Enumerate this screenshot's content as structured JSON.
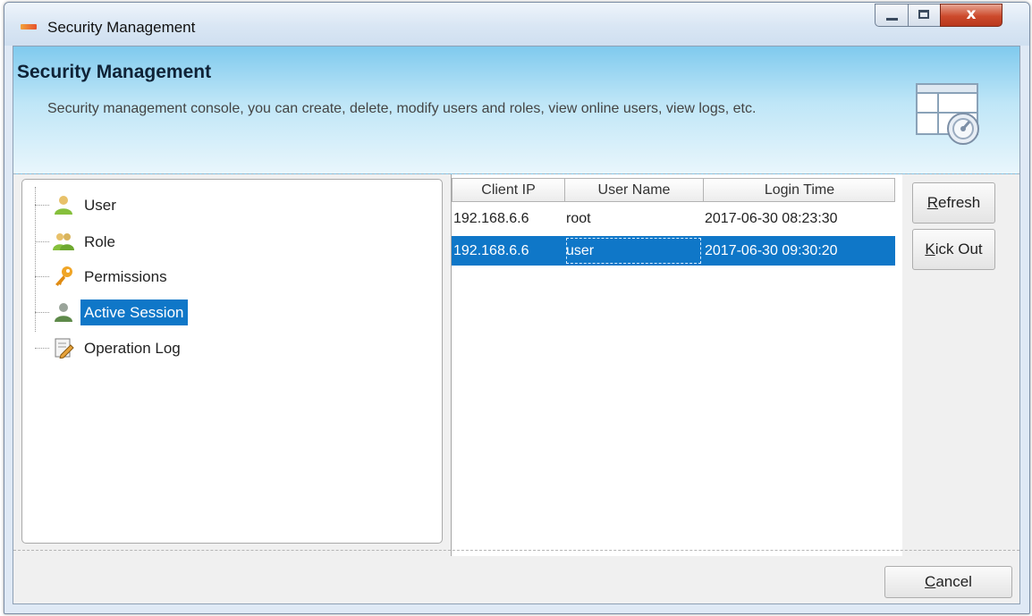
{
  "window": {
    "title": "Security Management",
    "logo_icon": "app-logo-icon",
    "controls": {
      "minimize_icon": "minimize-icon",
      "maximize_icon": "maximize-icon",
      "close_icon": "close-icon",
      "close_glyph": "x"
    }
  },
  "header": {
    "title": "Security Management",
    "description": "Security management console, you can create, delete, modify users and roles, view online users, view logs, etc.",
    "art_icon": "security-console-icon"
  },
  "tree": {
    "items": [
      {
        "label": "User",
        "icon": "user-icon",
        "selected": false
      },
      {
        "label": "Role",
        "icon": "role-icon",
        "selected": false
      },
      {
        "label": "Permissions",
        "icon": "key-icon",
        "selected": false
      },
      {
        "label": "Active Session",
        "icon": "session-user-icon",
        "selected": true
      },
      {
        "label": "Operation Log",
        "icon": "log-icon",
        "selected": false
      }
    ]
  },
  "sessions": {
    "columns": [
      "Client IP",
      "User Name",
      "Login Time"
    ],
    "rows": [
      {
        "client_ip": "192.168.6.6",
        "user_name": "root",
        "login_time": "2017-06-30 08:23:30",
        "selected": false
      },
      {
        "client_ip": "192.168.6.6",
        "user_name": "user",
        "login_time": "2017-06-30 09:30:20",
        "selected": true
      }
    ]
  },
  "actions": {
    "refresh": {
      "mnemonic": "R",
      "rest": "efresh"
    },
    "kick_out": {
      "mnemonic": "K",
      "rest": "ick Out"
    },
    "cancel": {
      "mnemonic": "C",
      "rest": "ancel"
    }
  },
  "colors": {
    "selection": "#0f77c8",
    "header_top": "#7fcaee",
    "header_bottom": "#e9f6fc"
  }
}
